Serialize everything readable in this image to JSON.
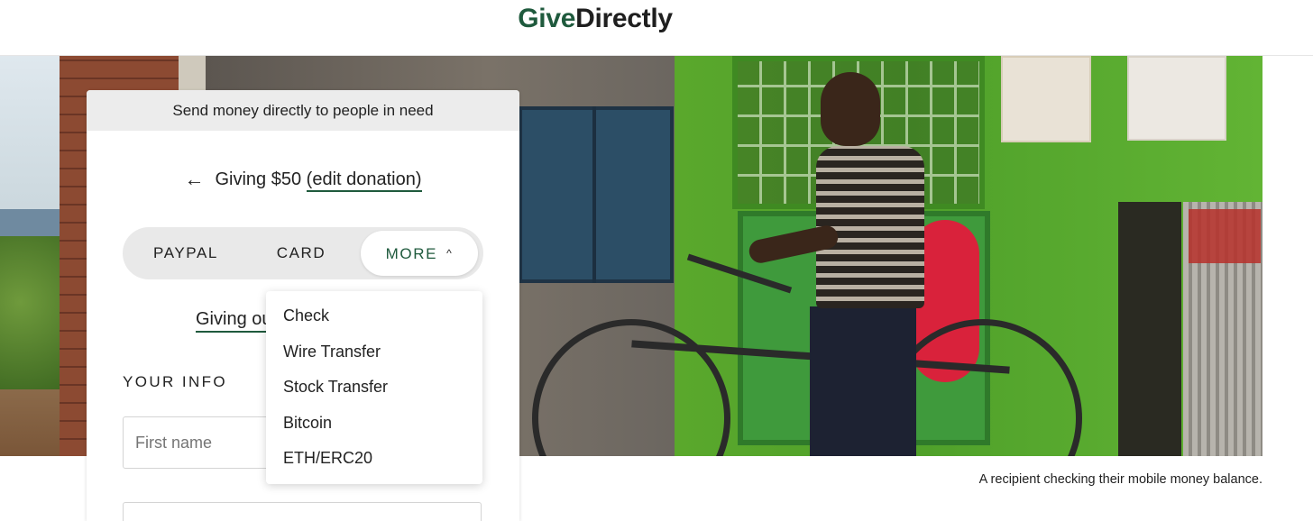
{
  "header": {
    "logo_give": "Give",
    "logo_directly": "Directly"
  },
  "card": {
    "header_text": "Send money directly to people in need",
    "back_icon": "arrow-left-icon",
    "giving_text": "Giving $50",
    "edit_link": "(edit donation)",
    "tabs": {
      "paypal": "PAYPAL",
      "card": "CARD",
      "more": "MORE",
      "more_icon": "chevron-up-icon",
      "active": "MORE"
    },
    "giving_out_link": "Giving out",
    "section_label": "YOUR INFO",
    "first_name_placeholder": "First name"
  },
  "dropdown": {
    "items": [
      "Check",
      "Wire Transfer",
      "Stock Transfer",
      "Bitcoin",
      "ETH/ERC20"
    ]
  },
  "caption": "A recipient checking their mobile money balance.",
  "colors": {
    "brand_green": "#1f5a3d",
    "text": "#222222",
    "tab_bg": "#e9e9e9",
    "card_header_bg": "#ececec"
  }
}
